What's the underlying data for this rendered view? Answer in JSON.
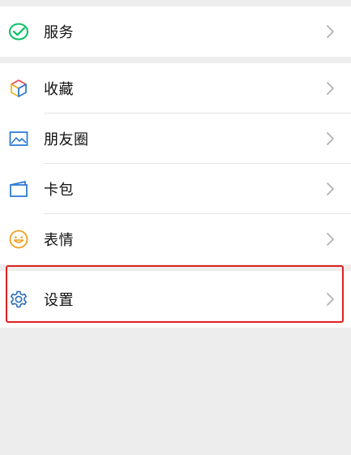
{
  "menu": {
    "group1": [
      {
        "label": "服务",
        "icon": "wechat-pay-check-icon"
      }
    ],
    "group2": [
      {
        "label": "收藏",
        "icon": "favorites-cube-icon"
      },
      {
        "label": "朋友圈",
        "icon": "moments-image-icon"
      },
      {
        "label": "卡包",
        "icon": "card-wallet-icon"
      },
      {
        "label": "表情",
        "icon": "smiley-icon"
      },
      {
        "label": "设置",
        "icon": "gear-icon"
      }
    ]
  },
  "colors": {
    "background": "#ededed",
    "row_background": "#ffffff",
    "highlight_border": "#e02020",
    "service_green": "#07c160",
    "moments_blue": "#2f7bd6",
    "emoji_orange": "#f0a020",
    "settings_blue": "#2a6fb7"
  }
}
